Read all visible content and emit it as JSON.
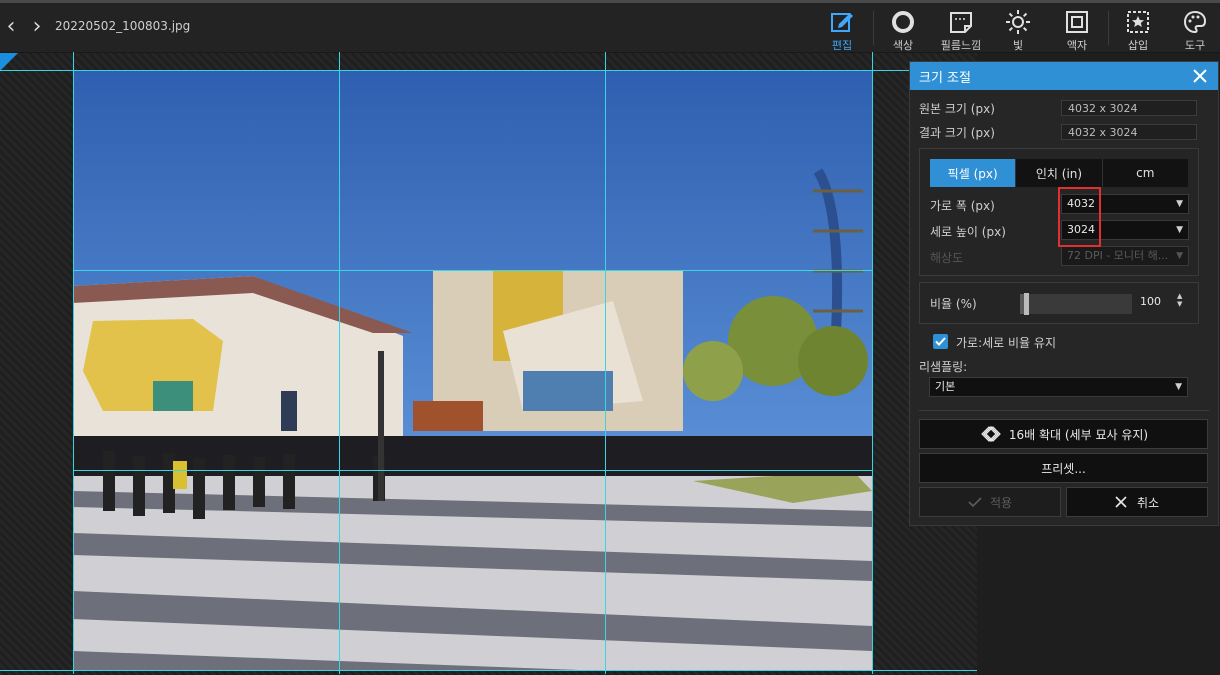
{
  "file": {
    "name": "20220502_100803.jpg"
  },
  "nav": {
    "back_glyph": "‹",
    "forward_glyph": "›"
  },
  "toolbar": {
    "tools": [
      {
        "label": "편집",
        "icon": "edit-icon",
        "active": true
      },
      {
        "label": "색상",
        "icon": "color-circle-icon"
      },
      {
        "label": "필름느낌",
        "icon": "film-icon"
      },
      {
        "label": "빛",
        "icon": "sun-icon"
      },
      {
        "label": "액자",
        "icon": "frame-icon"
      },
      {
        "label": "삽입",
        "icon": "insert-star-icon"
      },
      {
        "label": "도구",
        "icon": "palette-icon"
      }
    ]
  },
  "panel": {
    "title": "크기 조절",
    "original_label": "원본 크기 (px)",
    "original_value": "4032 x 3024",
    "result_label": "결과 크기 (px)",
    "result_value": "4032 x 3024",
    "units": {
      "tabs": [
        "픽셀 (px)",
        "인치 (in)",
        "cm"
      ],
      "active": 0
    },
    "width_label": "가로 폭 (px)",
    "width_value": "4032",
    "height_label": "세로 높이 (px)",
    "height_value": "3024",
    "resolution_label": "해상도",
    "resolution_value": "72 DPI - 모니터 해...",
    "ratio_label": "비율 (%)",
    "ratio_value": "100",
    "ratio_slider_fraction": 0.05,
    "keep_ratio_label": "가로:세로 비율 유지",
    "keep_ratio_checked": true,
    "resampling_label": "리샘플링:",
    "resampling_value": "기본",
    "upscale_label": "16배 확대 (세부 묘사 유지)",
    "preset_label": "프리셋...",
    "apply_label": "적용",
    "cancel_label": "취소"
  },
  "colors": {
    "accent": "#2f90d6",
    "guide": "#35d7e6",
    "highlight": "#e03030"
  }
}
